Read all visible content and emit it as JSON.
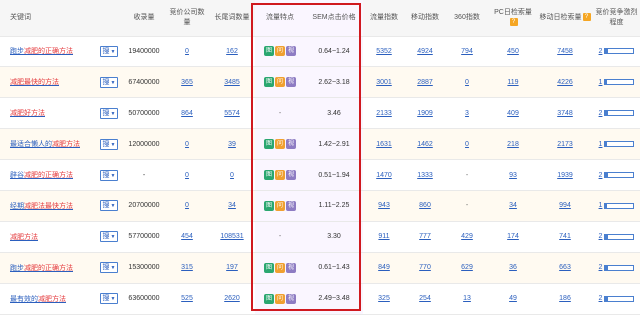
{
  "headers": {
    "keyword": "关键词",
    "volume": "收录量",
    "bid_companies": "竞价公司数量",
    "long_tail": "长尾词数量",
    "traffic_features": "流量特点",
    "sem_price": "SEM点击价格",
    "traffic_index": "流量指数",
    "mobile_index": "移动指数",
    "index_360": "360指数",
    "pc_daily": "PC日检索量",
    "mobile_daily": "移动日检索量",
    "competition": "竞价竞争激烈程度"
  },
  "select_label": "搜",
  "select_arrow": "▼",
  "qmark": "?",
  "tag_labels": {
    "g": "图",
    "o": "问",
    "p": "视"
  },
  "colors": {
    "accent_red": "#d0191f",
    "link_blue": "#2b5fbe",
    "tag_green": "#2ba770",
    "tag_orange": "#f0a030",
    "tag_purple": "#8e7cc3"
  },
  "rows": [
    {
      "kw_pre": "跑步",
      "kw_hl": "减肥的正确方法",
      "kw_post": "",
      "volume": "19400000",
      "bid": "0",
      "long_tail": "162",
      "tags": [
        "g",
        "o",
        "p"
      ],
      "sem": "0.64~1.24",
      "traffic": "5352",
      "mobile": "4924",
      "i360": "794",
      "pc": "450",
      "mob_daily": "7458",
      "comp_num": "2",
      "comp_level": 0.08
    },
    {
      "kw_pre": "",
      "kw_hl": "减肥最快的方法",
      "kw_post": "",
      "volume": "67400000",
      "bid": "365",
      "long_tail": "3485",
      "tags": [
        "g",
        "o",
        "p"
      ],
      "sem": "2.62~3.18",
      "traffic": "3001",
      "mobile": "2887",
      "i360": "0",
      "pc": "119",
      "mob_daily": "4226",
      "comp_num": "1",
      "comp_level": 0.06
    },
    {
      "kw_pre": "",
      "kw_hl": "减肥好方法",
      "kw_post": "",
      "volume": "50700000",
      "bid": "864",
      "long_tail": "5574",
      "tags": [],
      "sem": "3.46",
      "traffic": "2133",
      "mobile": "1909",
      "i360": "3",
      "pc": "409",
      "mob_daily": "3748",
      "comp_num": "2",
      "comp_level": 0.08
    },
    {
      "kw_pre": "最适合懒人的",
      "kw_hl": "减肥方法",
      "kw_post": "",
      "volume": "12000000",
      "bid": "0",
      "long_tail": "39",
      "tags": [
        "g",
        "o",
        "p"
      ],
      "sem": "1.42~2.91",
      "traffic": "1631",
      "mobile": "1462",
      "i360": "0",
      "pc": "218",
      "mob_daily": "2173",
      "comp_num": "1",
      "comp_level": 0.06
    },
    {
      "kw_pre": "辟谷",
      "kw_hl": "减肥的正确方法",
      "kw_post": "",
      "volume": "-",
      "bid": "0",
      "long_tail": "0",
      "tags": [
        "g",
        "o",
        "p"
      ],
      "sem": "0.51~1.94",
      "traffic": "1470",
      "mobile": "1333",
      "i360": "-",
      "pc": "93",
      "mob_daily": "1939",
      "comp_num": "2",
      "comp_level": 0.08
    },
    {
      "kw_pre": "经期",
      "kw_hl": "减肥法最快方法",
      "kw_post": "",
      "volume": "20700000",
      "bid": "0",
      "long_tail": "34",
      "tags": [
        "g",
        "o",
        "p"
      ],
      "sem": "1.11~2.25",
      "traffic": "943",
      "mobile": "860",
      "i360": "-",
      "pc": "34",
      "mob_daily": "994",
      "comp_num": "1",
      "comp_level": 0.06
    },
    {
      "kw_pre": "",
      "kw_hl": "减肥方法",
      "kw_post": "",
      "volume": "57700000",
      "bid": "454",
      "long_tail": "108531",
      "tags": [],
      "sem": "3.30",
      "traffic": "911",
      "mobile": "777",
      "i360": "429",
      "pc": "174",
      "mob_daily": "741",
      "comp_num": "2",
      "comp_level": 0.08
    },
    {
      "kw_pre": "跑步",
      "kw_hl": "减肥的正确方法",
      "kw_post": "",
      "volume": "15300000",
      "bid": "315",
      "long_tail": "197",
      "tags": [
        "g",
        "o",
        "p"
      ],
      "sem": "0.61~1.43",
      "traffic": "849",
      "mobile": "770",
      "i360": "629",
      "pc": "36",
      "mob_daily": "663",
      "comp_num": "2",
      "comp_level": 0.08
    },
    {
      "kw_pre": "最有效的",
      "kw_hl": "减肥方法",
      "kw_post": "",
      "volume": "63600000",
      "bid": "525",
      "long_tail": "2620",
      "tags": [
        "g",
        "o",
        "p"
      ],
      "sem": "2.49~3.48",
      "traffic": "325",
      "mobile": "254",
      "i360": "13",
      "pc": "49",
      "mob_daily": "186",
      "comp_num": "2",
      "comp_level": 0.08
    }
  ]
}
